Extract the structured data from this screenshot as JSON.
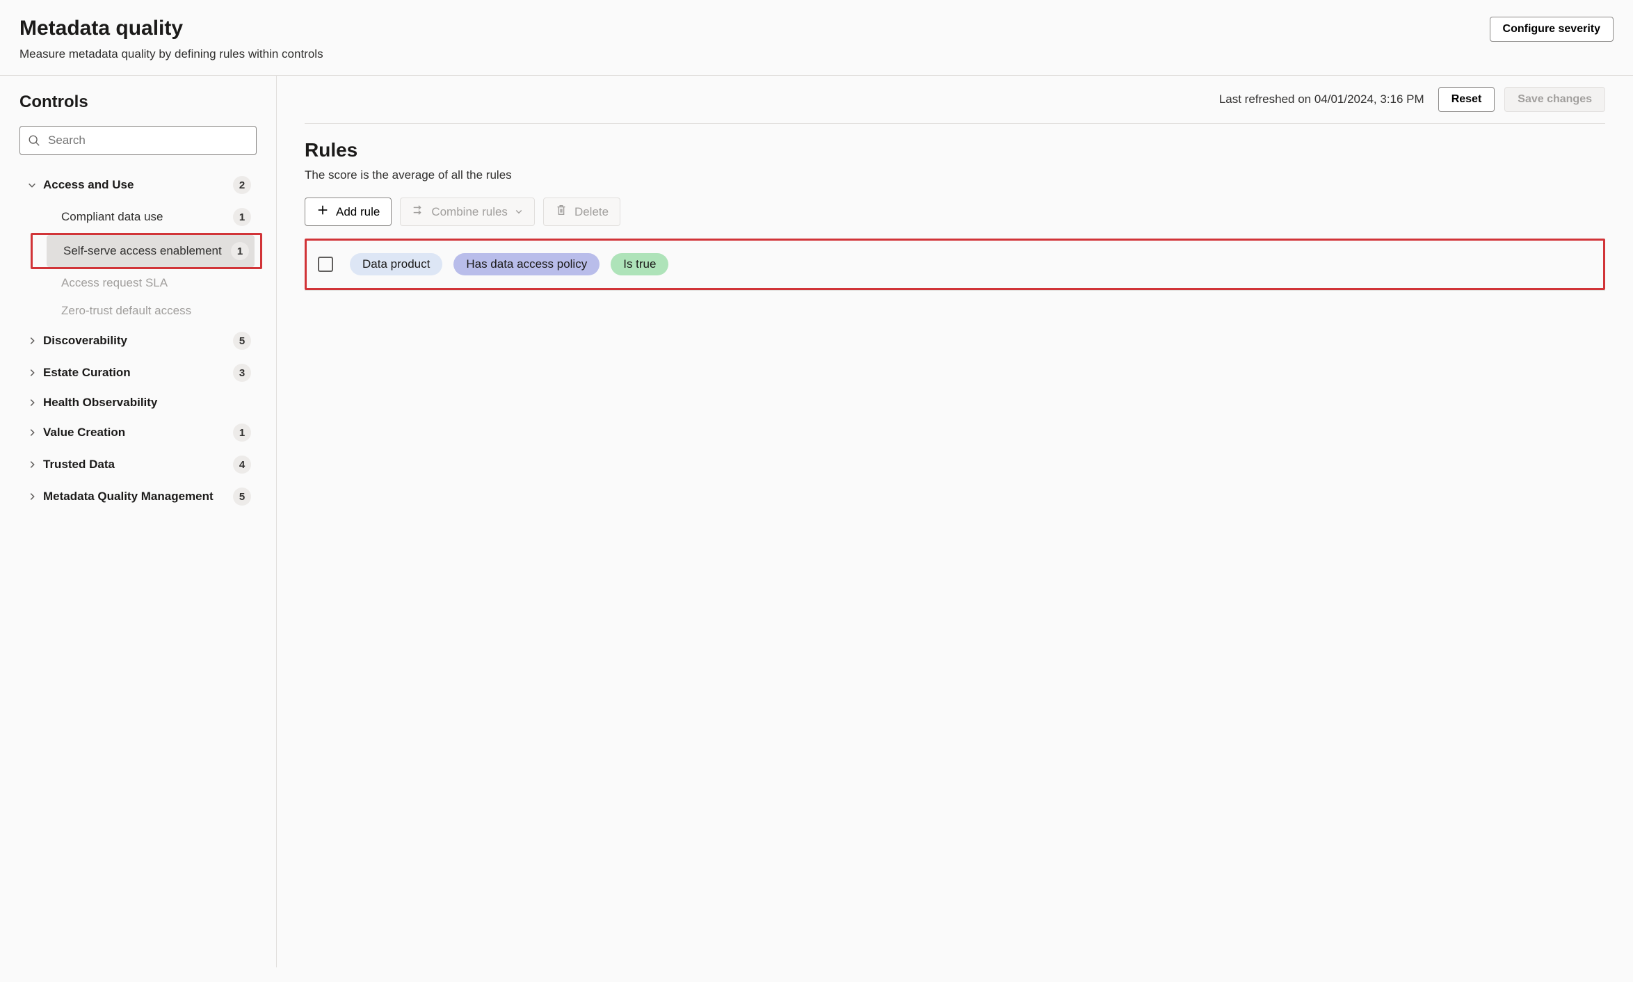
{
  "header": {
    "title": "Metadata quality",
    "subtitle": "Measure metadata quality by defining rules within controls",
    "configure_label": "Configure severity"
  },
  "sidebar": {
    "title": "Controls",
    "search_placeholder": "Search",
    "groups": [
      {
        "label": "Access and Use",
        "count": "2",
        "expanded": true,
        "children": [
          {
            "label": "Compliant data use",
            "count": "1",
            "dimmed": false,
            "selected": false
          },
          {
            "label": "Self-serve access enablement",
            "count": "1",
            "dimmed": false,
            "selected": true
          },
          {
            "label": "Access request SLA",
            "count": "",
            "dimmed": true,
            "selected": false
          },
          {
            "label": "Zero-trust default access",
            "count": "",
            "dimmed": true,
            "selected": false
          }
        ]
      },
      {
        "label": "Discoverability",
        "count": "5",
        "expanded": false
      },
      {
        "label": "Estate Curation",
        "count": "3",
        "expanded": false
      },
      {
        "label": "Health Observability",
        "count": "",
        "expanded": false
      },
      {
        "label": "Value Creation",
        "count": "1",
        "expanded": false
      },
      {
        "label": "Trusted Data",
        "count": "4",
        "expanded": false
      },
      {
        "label": "Metadata Quality Management",
        "count": "5",
        "expanded": false
      }
    ]
  },
  "main": {
    "refresh_text": "Last refreshed on 04/01/2024, 3:16 PM",
    "reset_label": "Reset",
    "save_label": "Save changes",
    "rules_title": "Rules",
    "rules_desc": "The score is the average of all the rules",
    "add_rule_label": "Add rule",
    "combine_label": "Combine rules",
    "delete_label": "Delete",
    "rule": {
      "pill1": "Data product",
      "pill2": "Has data access policy",
      "pill3": "Is true"
    }
  }
}
